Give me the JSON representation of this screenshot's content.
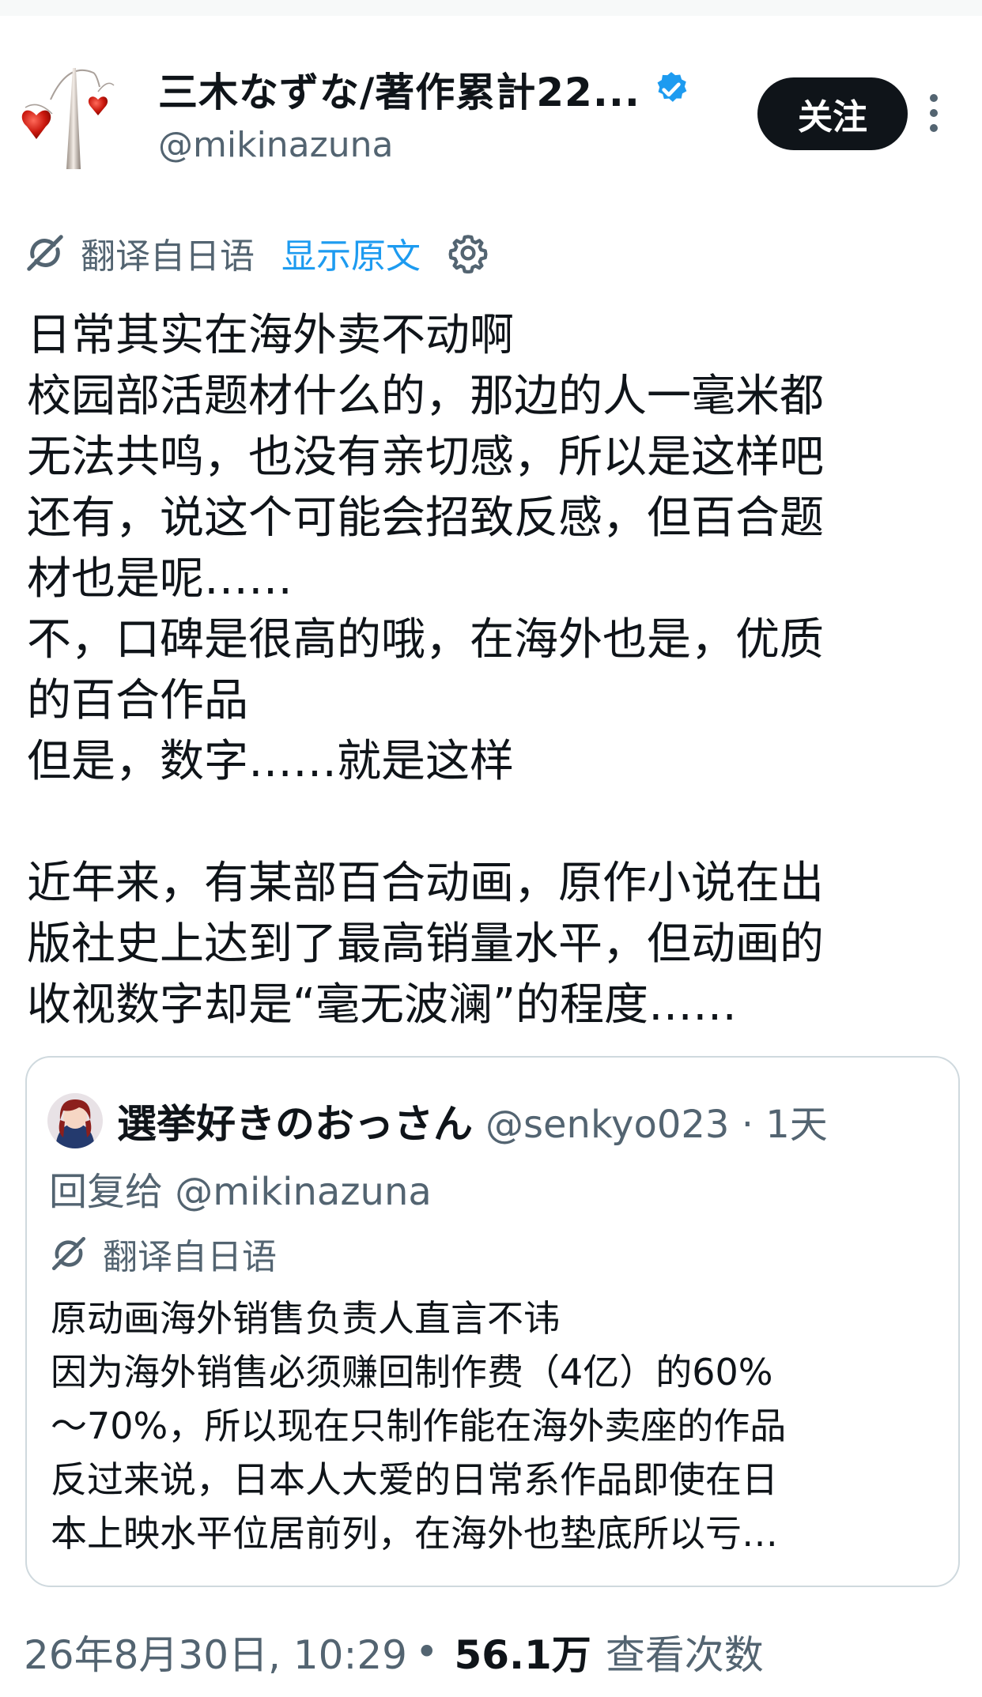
{
  "author": {
    "display_name": "三木なずな/著作累計22...",
    "handle": "@mikinazuna",
    "follow_label": "关注"
  },
  "translation": {
    "label": "翻译自日语",
    "show_original": "显示原文"
  },
  "post": {
    "lines": [
      "日常其实在海外卖不动啊",
      "校园部活题材什么的，那边的人一毫米都",
      "无法共鸣，也没有亲切感，所以是这样吧",
      "还有，说这个可能会招致反感，但百合题",
      "材也是呢……",
      "不，口碑是很高的哦，在海外也是，优质",
      "的百合作品",
      "但是，数字……就是这样",
      "近年来，有某部百合动画，原作小说在出",
      "版社史上达到了最高销量水平，但动画的",
      "收视数字却是“毫无波澜”的程度……"
    ]
  },
  "quote": {
    "name": "選挙好きのおっさん",
    "handle_time": "@senkyo023 · 1天",
    "reply_to": "回复给 @mikinazuna",
    "translation_label": "翻译自日语",
    "lines": [
      "原动画海外销售负责人直言不讳",
      "因为海外销售必须赚回制作费（4亿）的60%",
      "～70%，所以现在只制作能在海外卖座的作品",
      "反过来说，日本人大爱的日常系作品即使在日",
      "本上映水平位居前列，在海外也垫底所以亏…"
    ]
  },
  "meta": {
    "timestamp": "26年8月30日, 10:29",
    "separator": "•",
    "views": "56.1万",
    "views_label": "查看次数"
  },
  "colors": {
    "accent": "#1d9bf0",
    "text": "#0f1419",
    "muted": "#536471",
    "border": "#cfd9de"
  },
  "icons": [
    "heart-mobile-avatar-icon",
    "verified-badge-icon",
    "more-dots-icon",
    "translate-icon",
    "gear-icon"
  ]
}
